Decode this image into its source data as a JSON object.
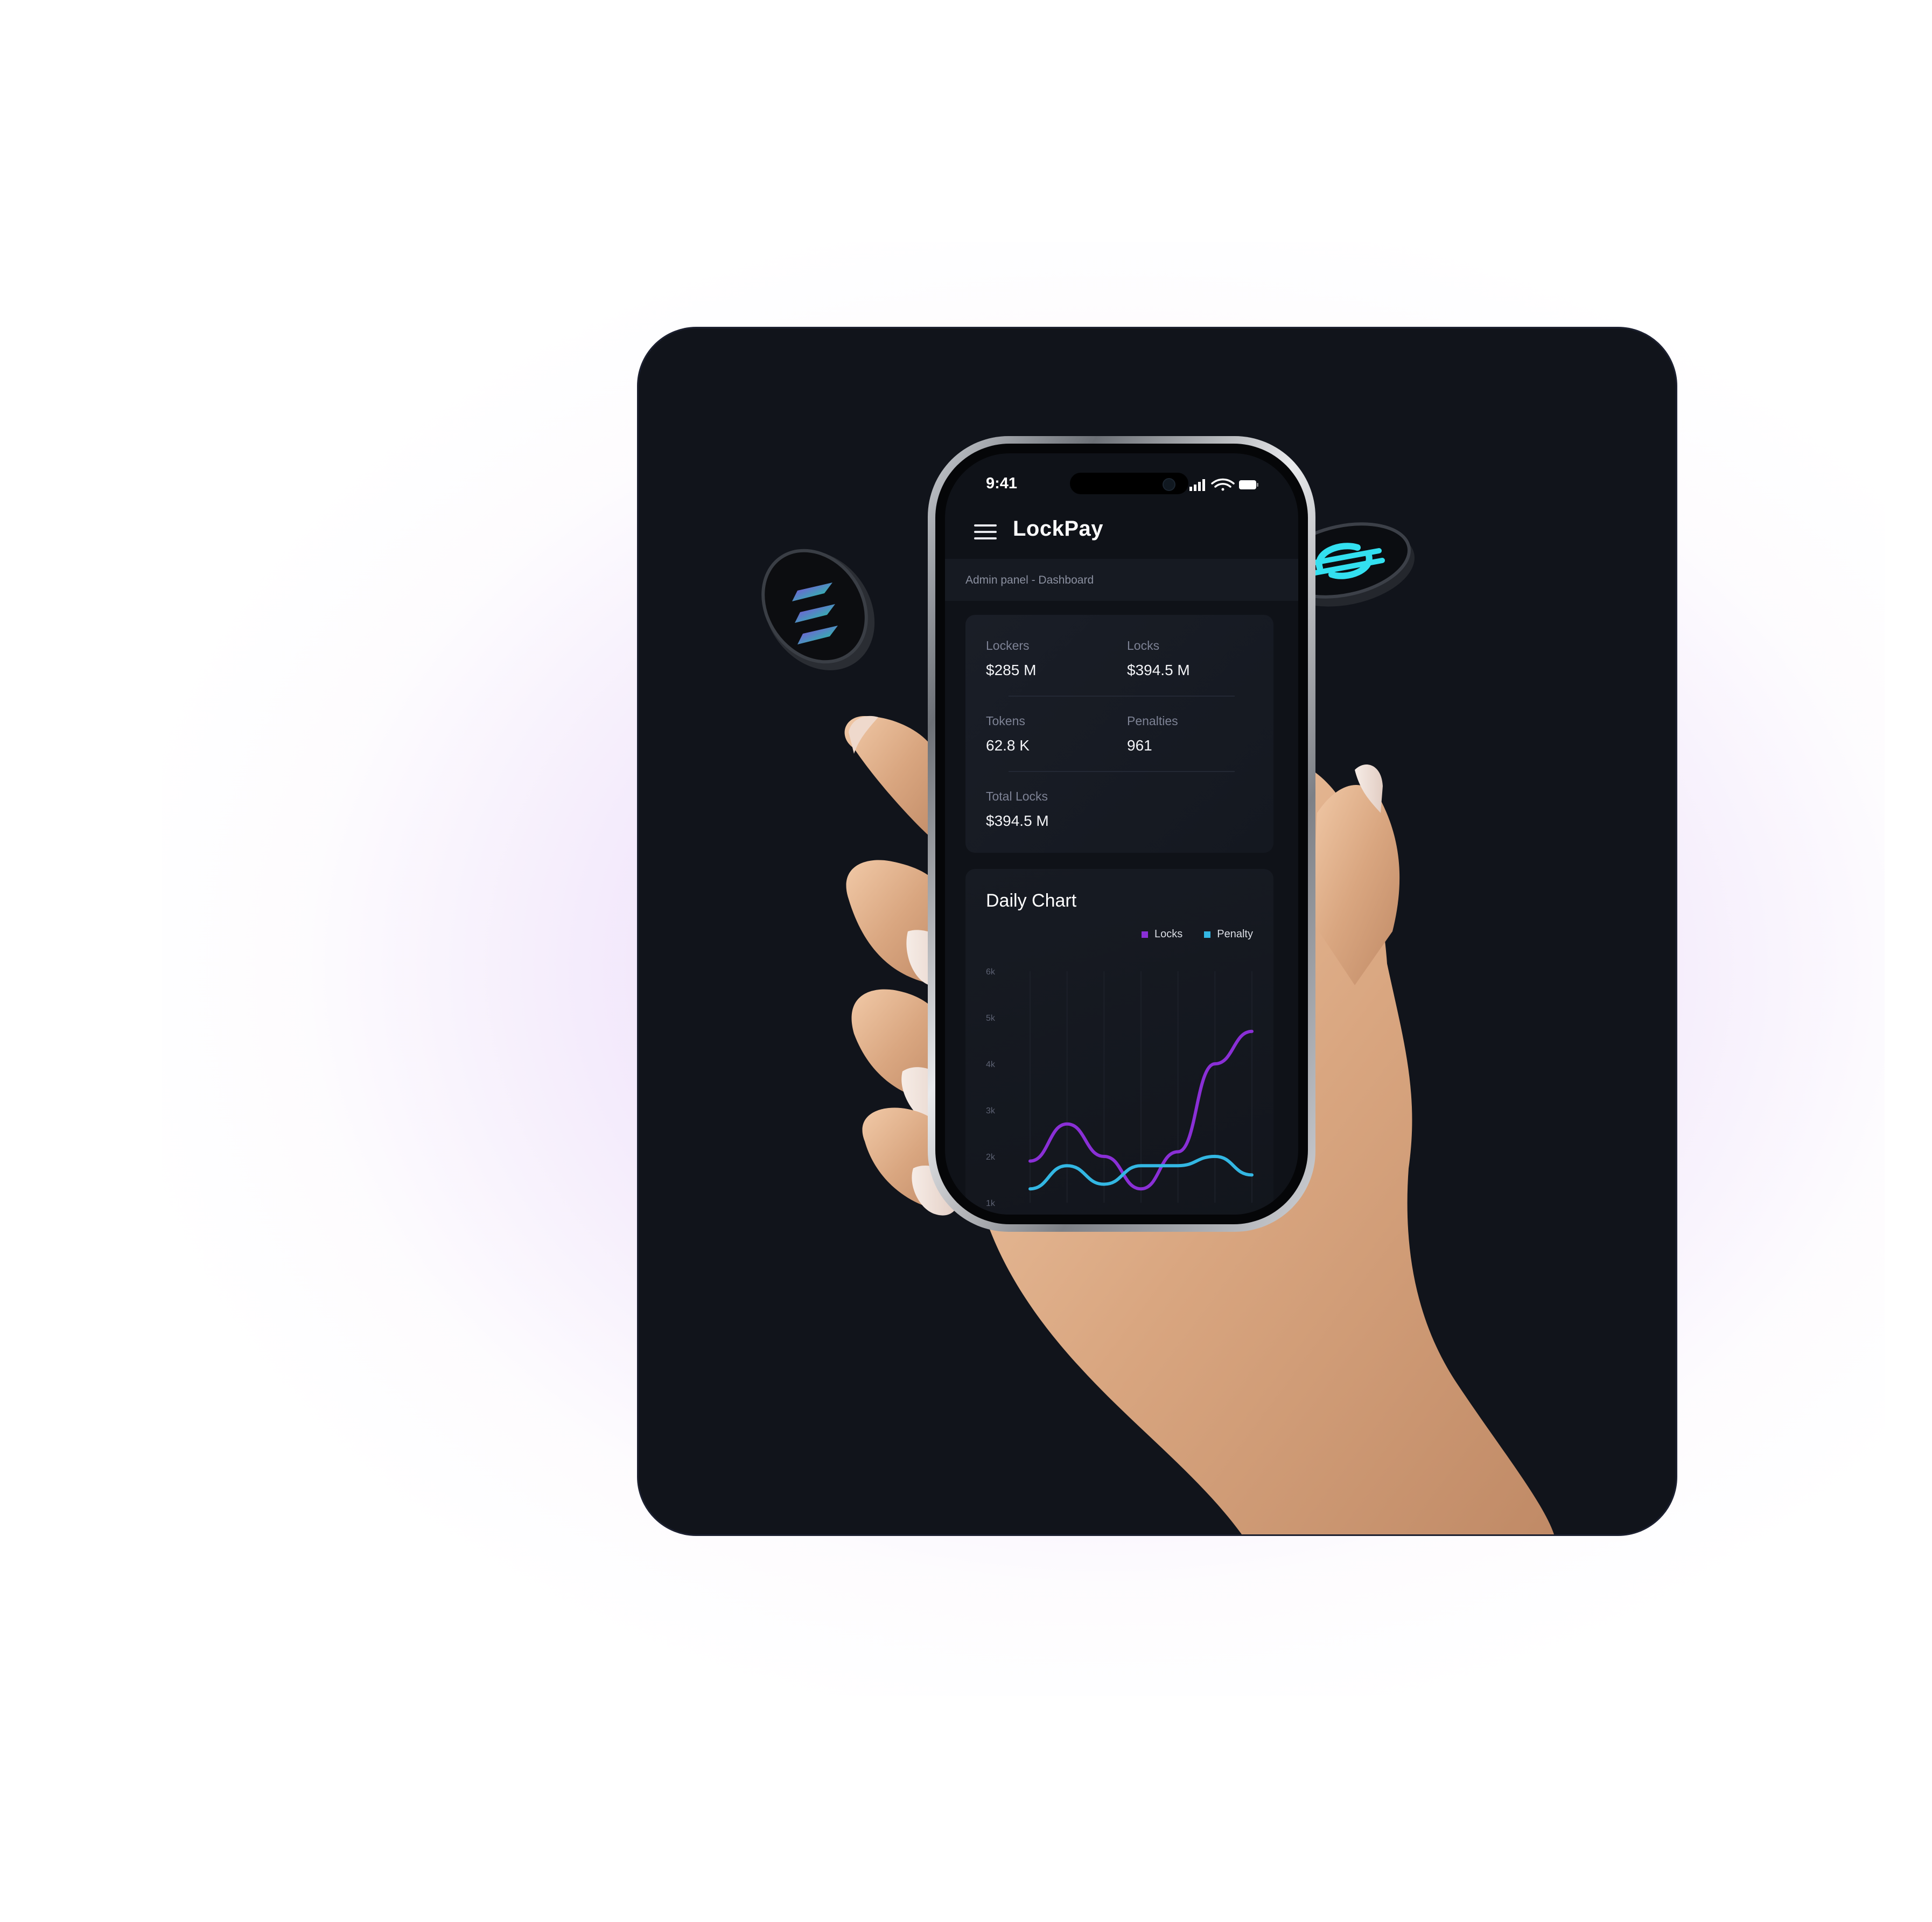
{
  "status_bar": {
    "time": "9:41"
  },
  "app": {
    "title": "LockPay"
  },
  "breadcrumb": "Admin panel - Dashboard",
  "stats": {
    "lockers": {
      "label": "Lockers",
      "value": "$285 M"
    },
    "locks": {
      "label": "Locks",
      "value": "$394.5 M"
    },
    "tokens": {
      "label": "Tokens",
      "value": "62.8 K"
    },
    "penalties": {
      "label": "Penalties",
      "value": "961"
    },
    "total_locks": {
      "label": "Total Locks",
      "value": "$394.5 M"
    }
  },
  "chart_data": {
    "type": "line",
    "title": "Daily Chart",
    "yticks": [
      "6k",
      "5k",
      "4k",
      "3k",
      "2k",
      "1k"
    ],
    "ylim": [
      1000,
      6000
    ],
    "grid": "vertical",
    "legend_position": "top-right",
    "series": [
      {
        "name": "Locks",
        "color": "#8a2fd6",
        "values": [
          1900,
          2700,
          2000,
          1300,
          2100,
          4000,
          4700
        ]
      },
      {
        "name": "Penalty",
        "color": "#33b7e3",
        "values": [
          1300,
          1800,
          1400,
          1800,
          1800,
          2000,
          1600
        ]
      }
    ]
  },
  "icons": {
    "menu": "hamburger-menu-icon",
    "coin_left": "solana-coin",
    "coin_right": "stellar-coin"
  }
}
